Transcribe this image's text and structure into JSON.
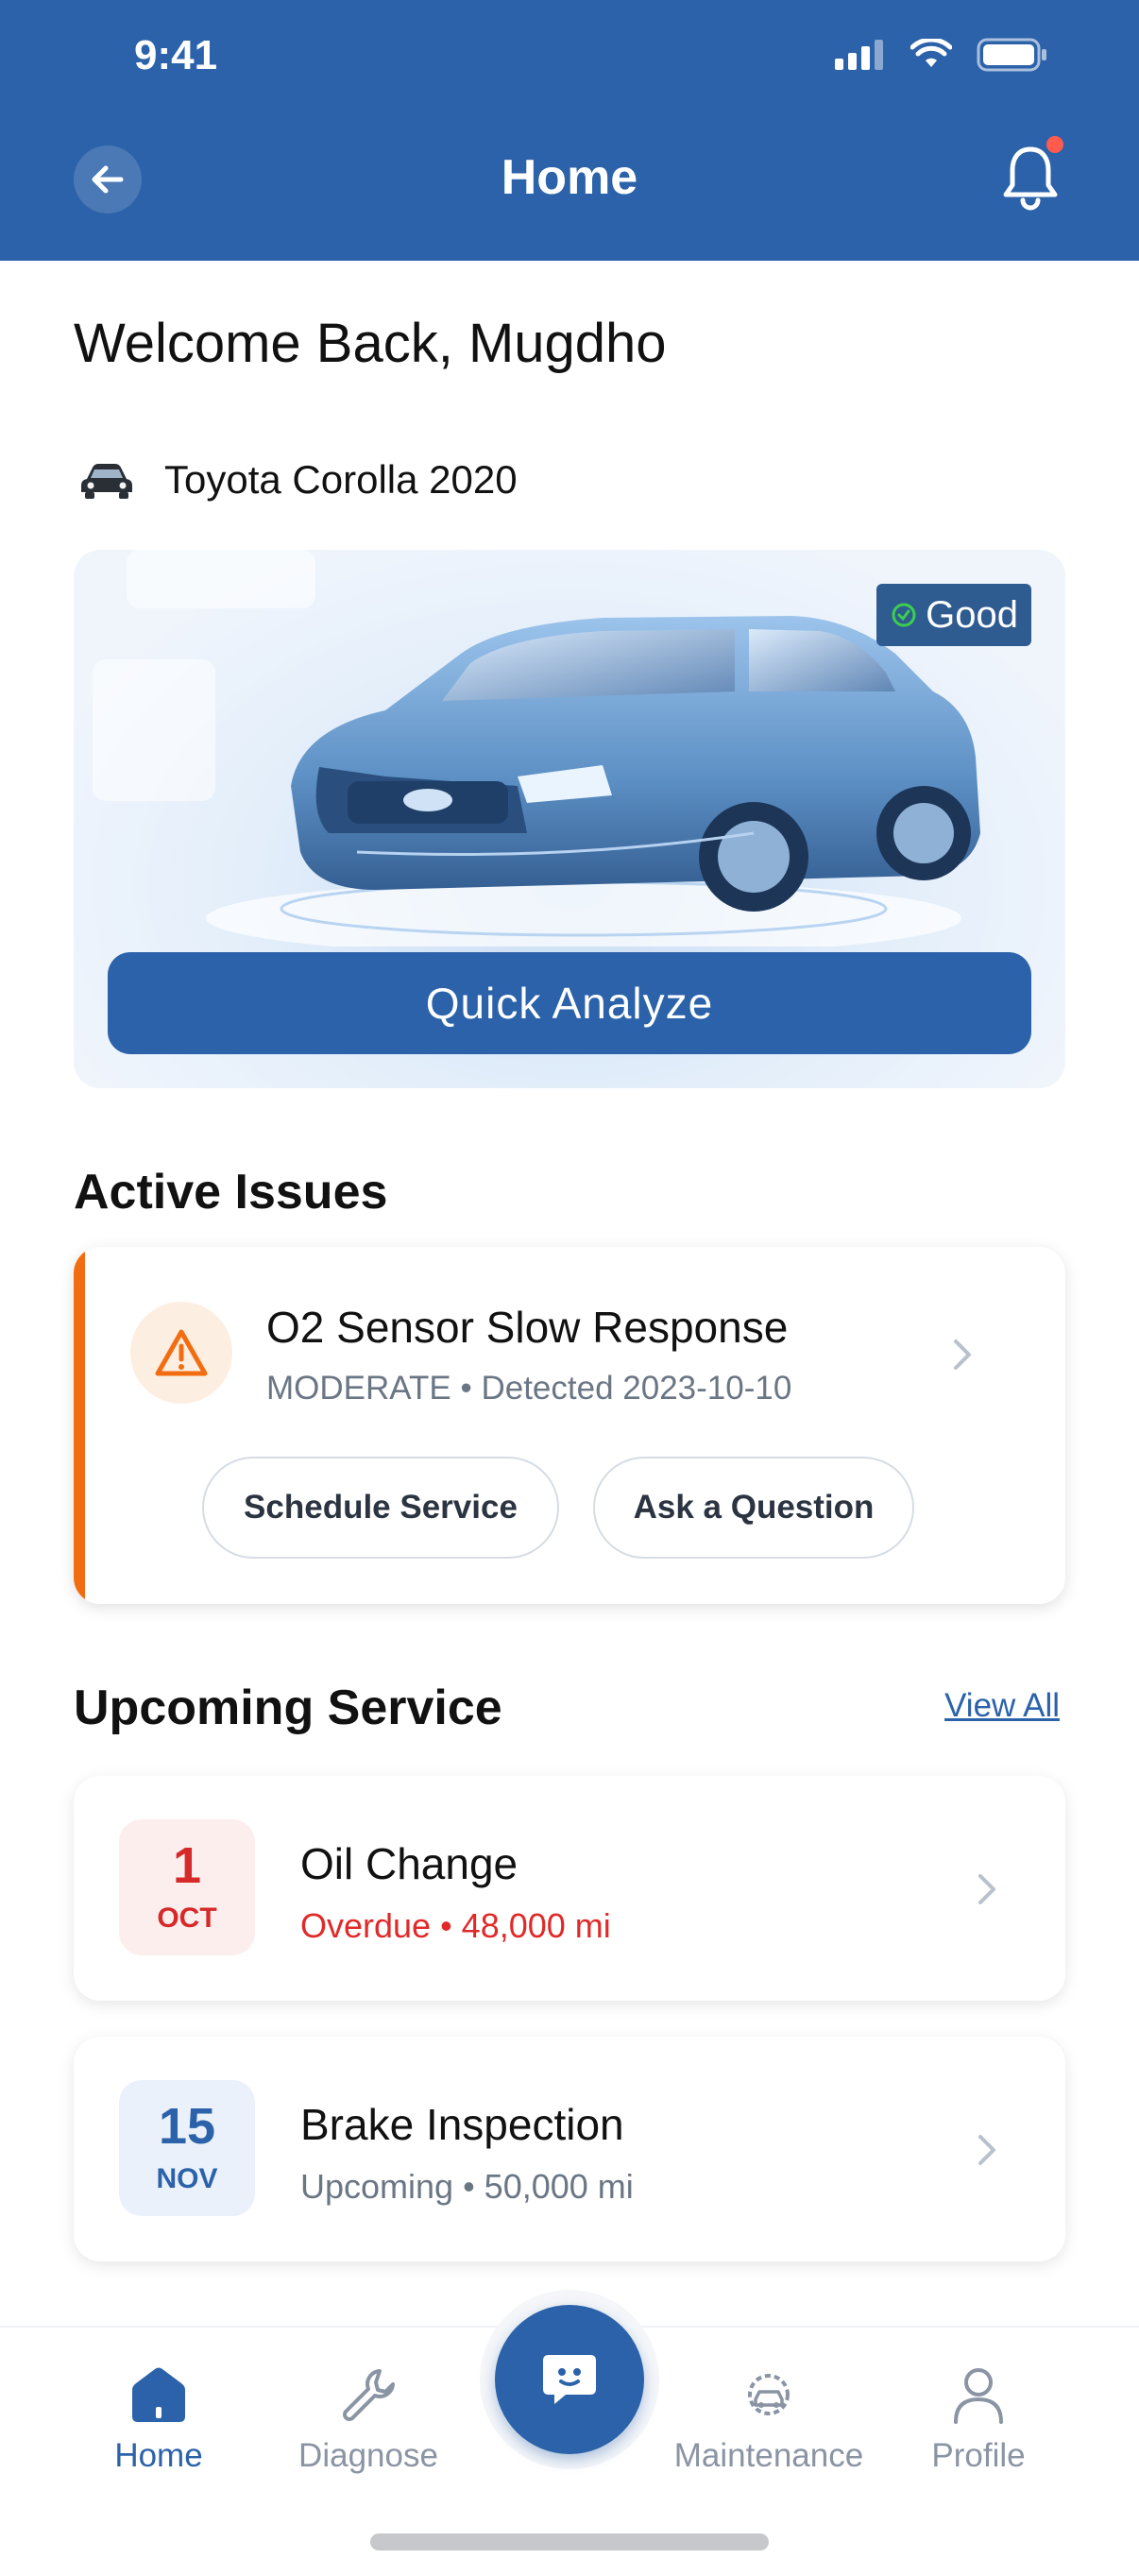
{
  "status_bar": {
    "time": "9:41"
  },
  "header": {
    "title": "Home"
  },
  "welcome": {
    "text": "Welcome Back, Mugdho"
  },
  "vehicle": {
    "name": "Toyota Corolla 2020"
  },
  "hero": {
    "health_badge": "Good",
    "quick_analyze_label": "Quick Analyze"
  },
  "active_issues": {
    "title": "Active Issues",
    "items": [
      {
        "title": "O2 Sensor Slow Response",
        "subtitle": "MODERATE • Detected 2023-10-10",
        "actions": [
          "Schedule Service",
          "Ask a Question"
        ]
      }
    ]
  },
  "upcoming_service": {
    "title": "Upcoming Service",
    "view_all_label": "View All",
    "items": [
      {
        "day": "1",
        "month": "OCT",
        "title": "Oil Change",
        "subtitle": "Overdue • 48,000 mi",
        "status": "overdue"
      },
      {
        "day": "15",
        "month": "NOV",
        "title": "Brake Inspection",
        "subtitle": "Upcoming • 50,000 mi",
        "status": "upcoming"
      }
    ]
  },
  "bottom_nav": {
    "items": [
      {
        "label": "Home",
        "icon": "home-icon",
        "active": true
      },
      {
        "label": "Diagnose",
        "icon": "wrench-icon",
        "active": false
      },
      {
        "label": "Maintenance",
        "icon": "gear-car-icon",
        "active": false
      },
      {
        "label": "Profile",
        "icon": "person-icon",
        "active": false
      }
    ],
    "center_icon": "chat-bot-icon"
  },
  "colors": {
    "primary": "#2b62a9",
    "warning": "#f26d12",
    "overdue": "#e02a2a",
    "good": "#3ccf4e"
  }
}
